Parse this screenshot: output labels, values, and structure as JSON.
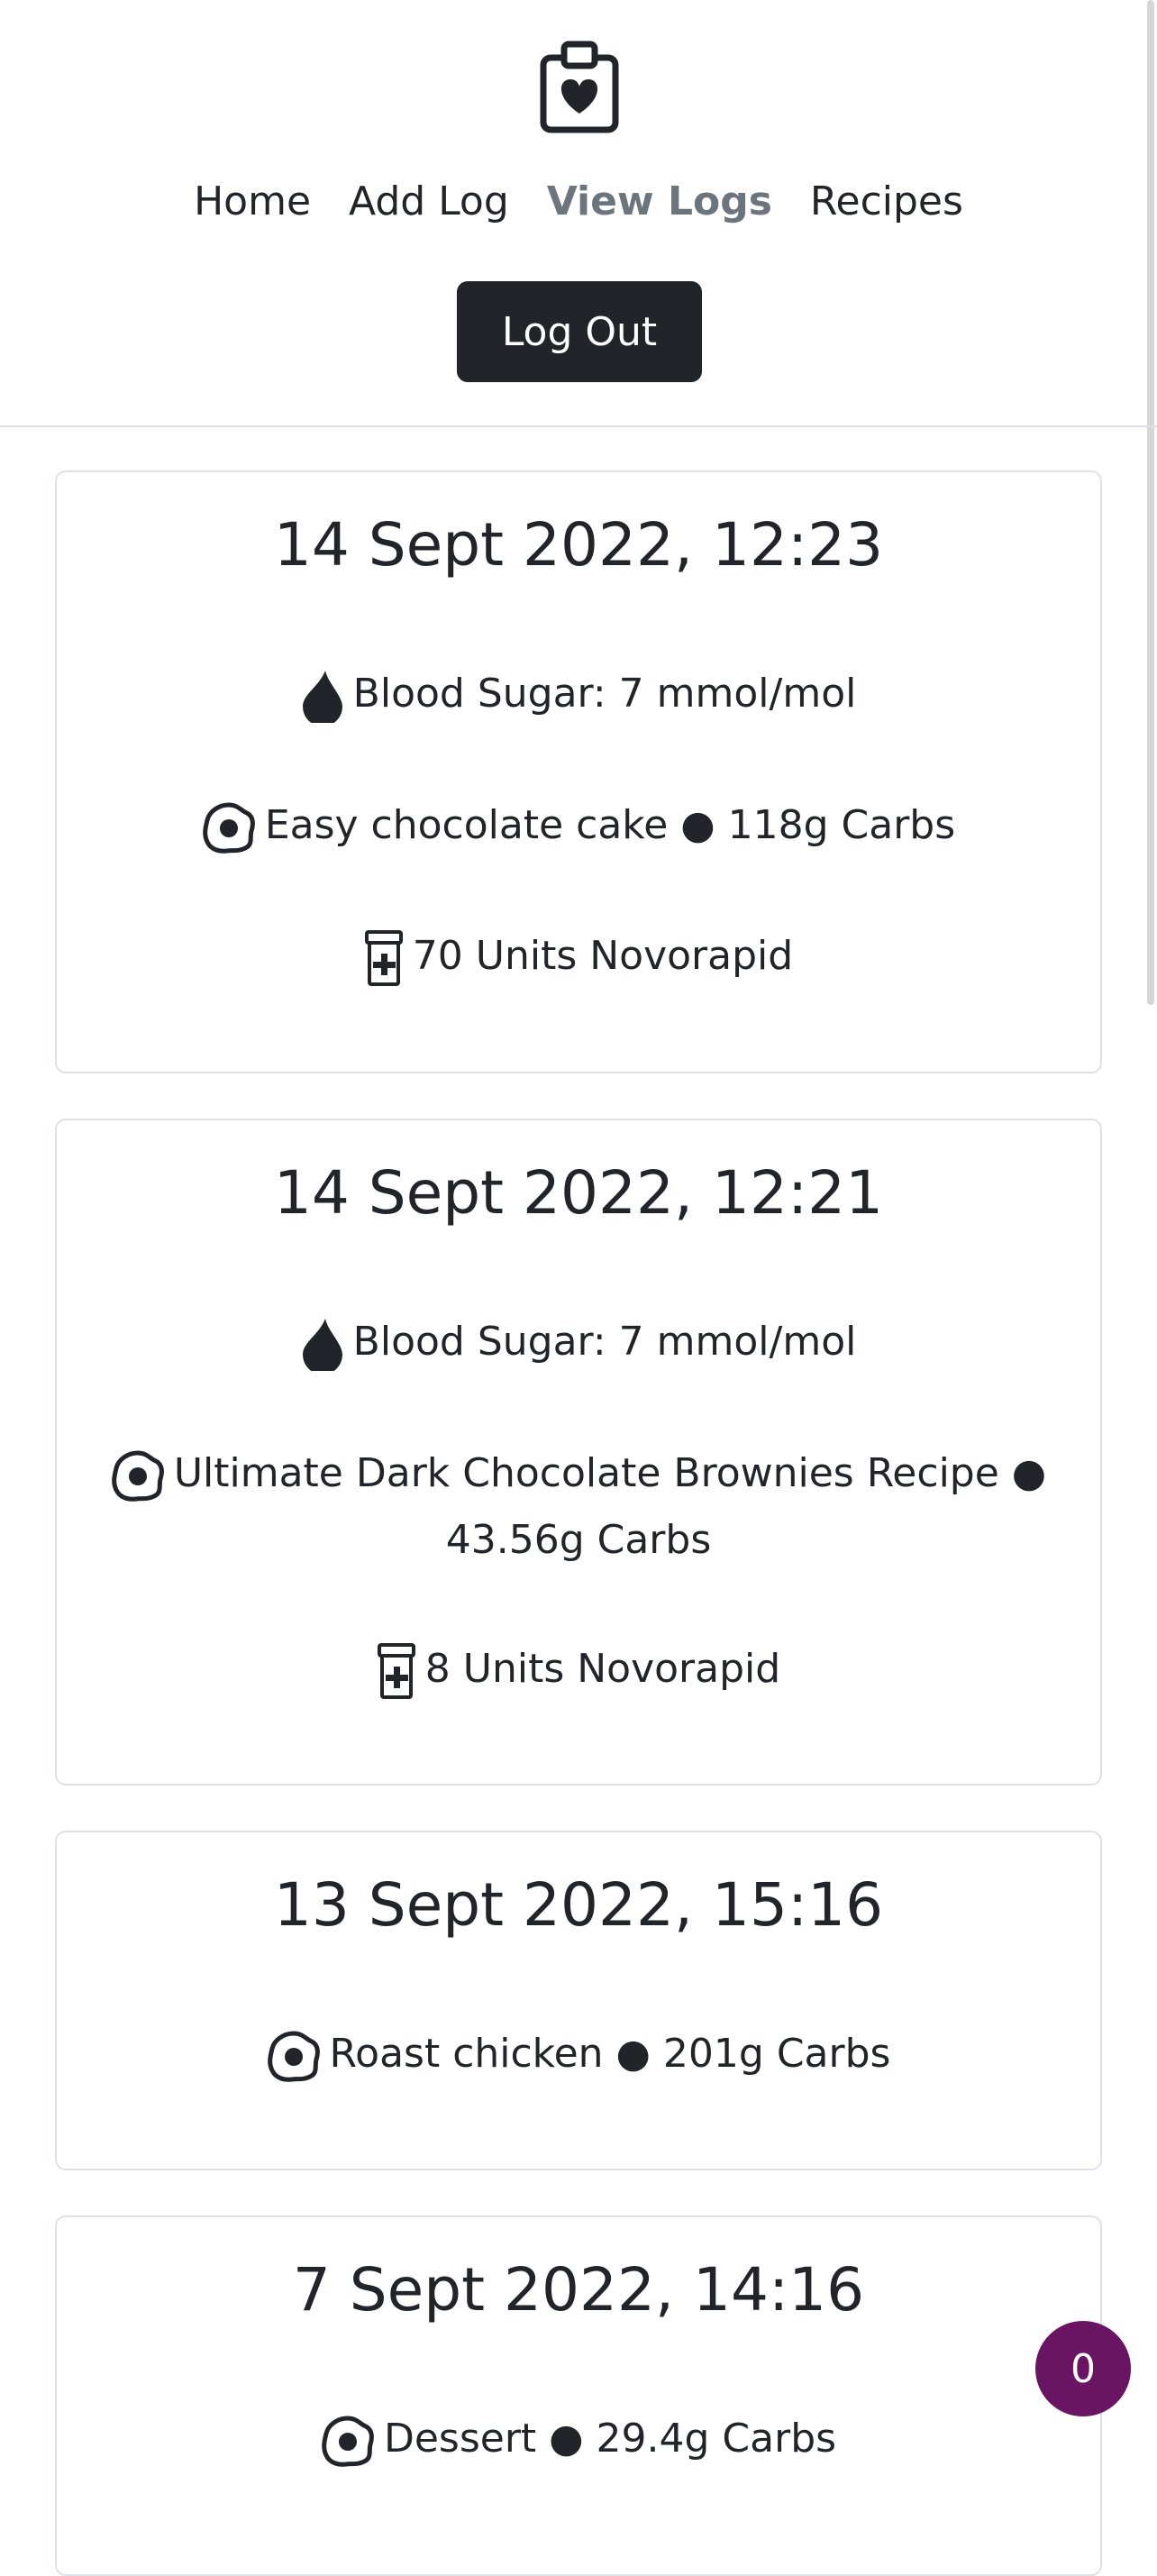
{
  "nav": {
    "items": [
      {
        "label": "Home"
      },
      {
        "label": "Add Log"
      },
      {
        "label": "View Logs"
      },
      {
        "label": "Recipes"
      }
    ],
    "active": "View Logs",
    "logout_label": "Log Out"
  },
  "logs": [
    {
      "date": "14 Sept 2022, 12:23",
      "blood_sugar": "Blood Sugar: 7 mmol/mol",
      "meal": "Easy chocolate cake ● 118g Carbs",
      "insulin": "70 Units Novorapid"
    },
    {
      "date": "14 Sept 2022, 12:21",
      "blood_sugar": "Blood Sugar: 7 mmol/mol",
      "meal_line1": "Ultimate Dark Chocolate Brownies Recipe ●",
      "meal_line2": "43.56g Carbs",
      "insulin": "8 Units Novorapid"
    },
    {
      "date": "13 Sept 2022, 15:16",
      "meal": "Roast chicken ● 201g Carbs"
    },
    {
      "date": "7 Sept 2022, 14:16",
      "meal": "Dessert ● 29.4g Carbs"
    }
  ],
  "badge": {
    "count": "0"
  },
  "icons": {
    "logo": "clipboard-heart-icon",
    "blood": "droplet-icon",
    "meal": "egg-fried-icon",
    "insulin": "capsule-prescription-icon"
  },
  "colors": {
    "text": "#212529",
    "nav_active": "#6c757d",
    "button": "#212529",
    "badge": "#6a1564"
  }
}
